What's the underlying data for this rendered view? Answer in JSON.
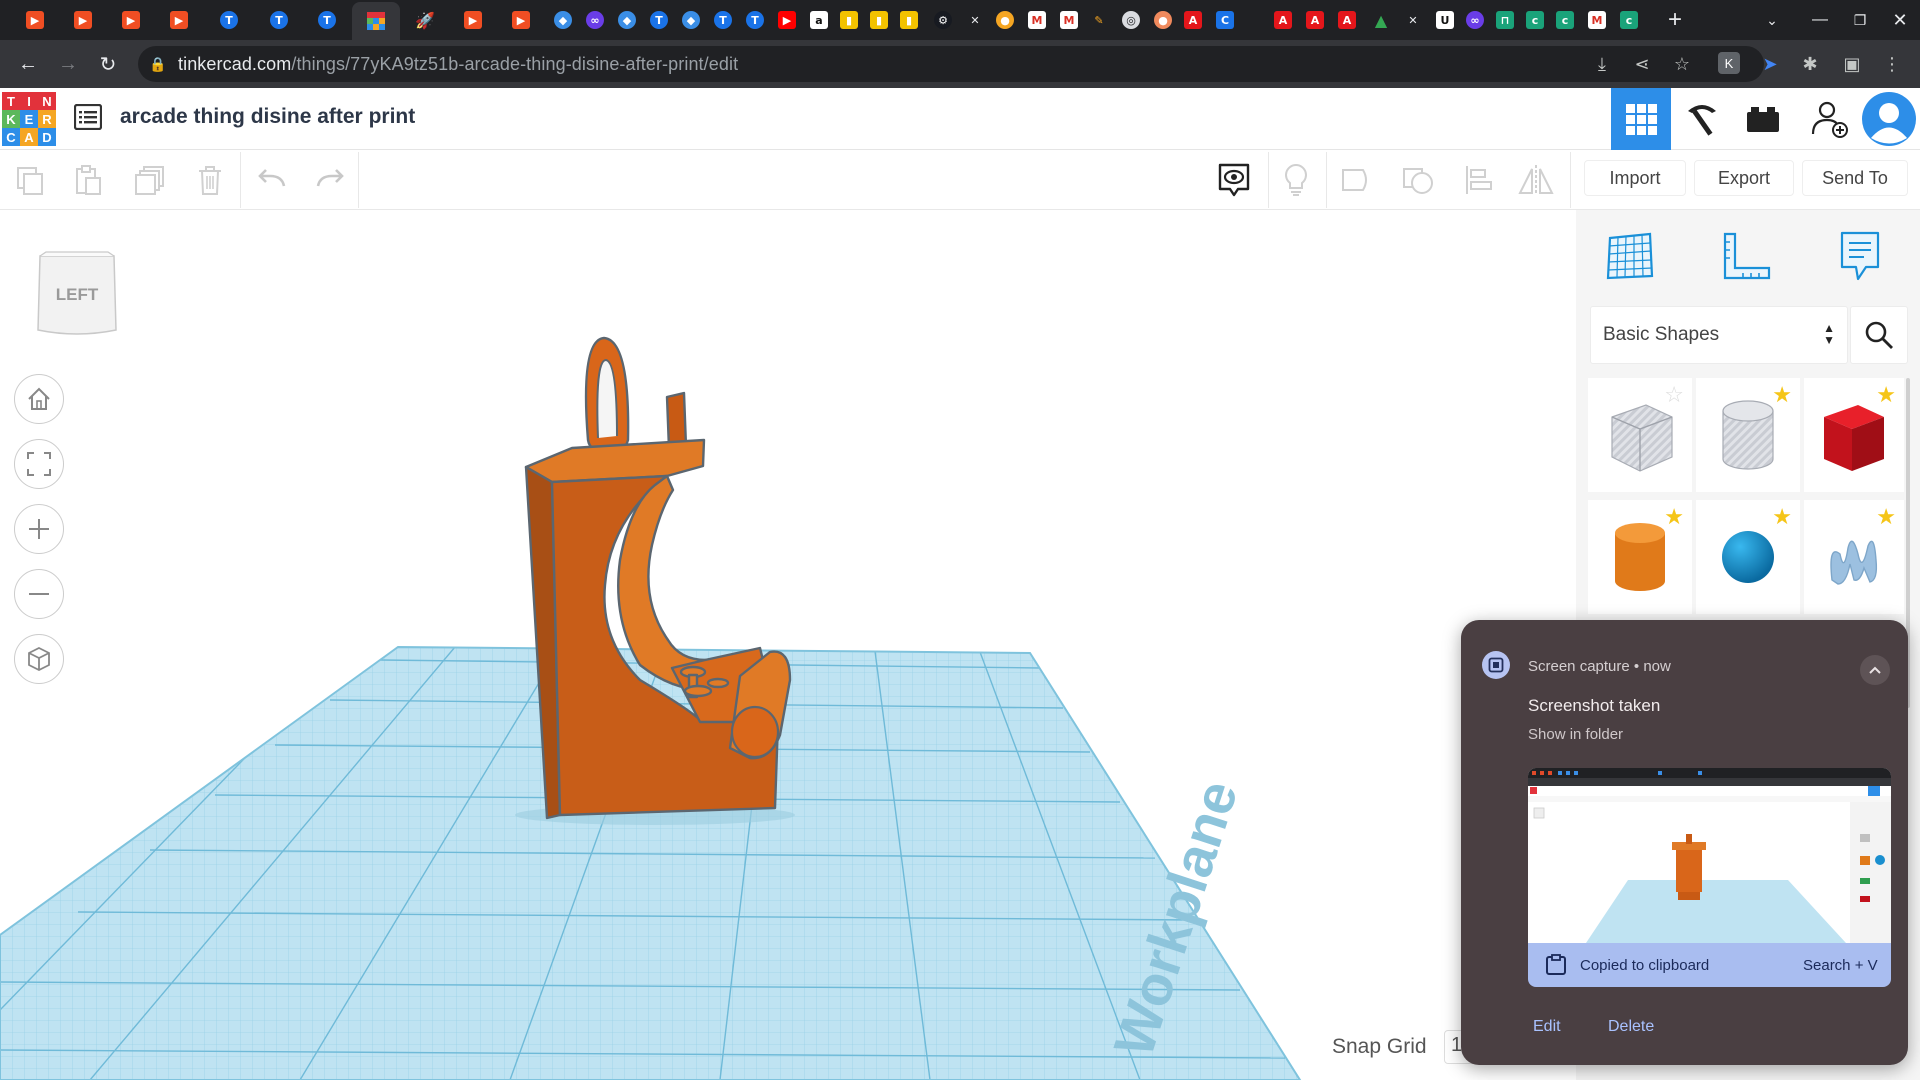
{
  "browser": {
    "url_host": "tinkercad.com",
    "url_path": "/things/77yKA9tz51b-arcade-thing-disine-after-print/edit",
    "tabs": [
      {
        "icon": "doc-orange-icon",
        "color": "#f04e23",
        "glyph": "▶"
      },
      {
        "icon": "doc-orange-icon",
        "color": "#f04e23",
        "glyph": "▶"
      },
      {
        "icon": "doc-orange-icon",
        "color": "#f04e23",
        "glyph": "▶"
      },
      {
        "icon": "doc-orange-icon",
        "color": "#f04e23",
        "glyph": "▶"
      },
      {
        "icon": "t-circle-icon",
        "color": "#1a73e8",
        "glyph": "T"
      },
      {
        "icon": "t-circle-icon",
        "color": "#1a73e8",
        "glyph": "T"
      },
      {
        "icon": "t-circle-icon",
        "color": "#1a73e8",
        "glyph": "T"
      }
    ],
    "colors": {
      "tabstrip": "#202124",
      "toolbar": "#35363a",
      "omnibox": "#202124"
    }
  },
  "app": {
    "logo_letters": [
      "T",
      "I",
      "N",
      "K",
      "E",
      "R",
      "C",
      "A",
      "D"
    ],
    "logo_colors": [
      "#e2323b",
      "#e2323b",
      "#e2323b",
      "#5cb85c",
      "#2d8ee8",
      "#f5a623",
      "#2d8ee8",
      "#f5a623",
      "#2d8ee8"
    ],
    "doc_title": "arcade thing disine after print",
    "accent": "#2d8ee8"
  },
  "edit_toolbar": {
    "import_label": "Import",
    "export_label": "Export",
    "send_to_label": "Send To"
  },
  "canvas": {
    "viewcube_label": "LEFT",
    "workplane_label": "Workplane",
    "snap_grid_label": "Snap Grid",
    "snap_grid_value": "1"
  },
  "shapes_panel": {
    "category": "Basic Shapes",
    "tiles": [
      {
        "name": "box-hole",
        "favorite": false
      },
      {
        "name": "cylinder-hole",
        "favorite": true
      },
      {
        "name": "box",
        "favorite": true
      },
      {
        "name": "cylinder",
        "favorite": true
      },
      {
        "name": "sphere",
        "favorite": true
      },
      {
        "name": "scribble",
        "favorite": true
      }
    ]
  },
  "notification": {
    "source": "Screen capture",
    "time": "now",
    "title": "Screenshot taken",
    "subtitle": "Show in folder",
    "clipboard_text": "Copied to clipboard",
    "clipboard_hint": "Search + V",
    "action_edit": "Edit",
    "action_delete": "Delete"
  }
}
